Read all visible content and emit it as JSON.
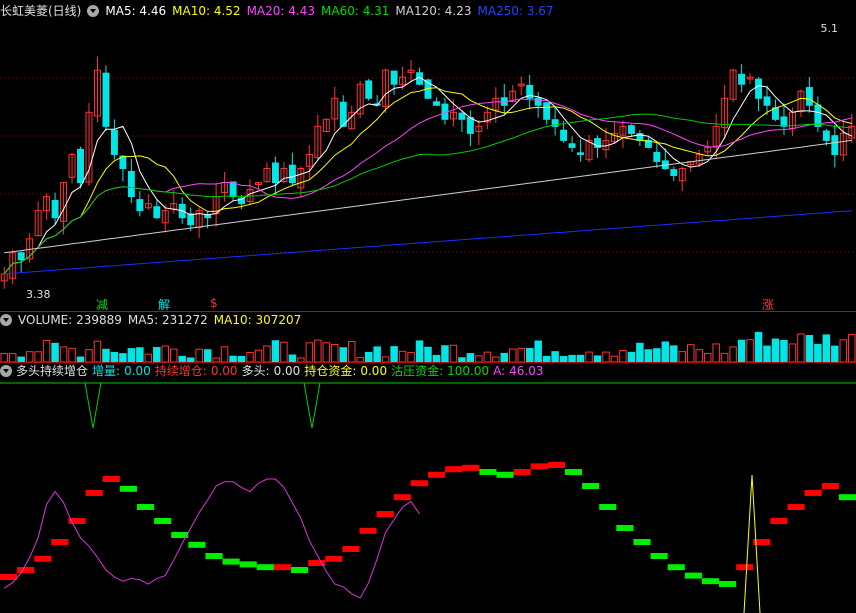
{
  "main_header": {
    "title": "长虹美菱(日线)",
    "ma5": "MA5: 4.46",
    "ma10": "MA10: 4.52",
    "ma20": "MA20: 4.43",
    "ma60": "MA60: 4.31",
    "ma120": "MA120: 4.23",
    "ma250": "MA250: 3.67"
  },
  "price_marks": {
    "high": "5.1",
    "low": "3.38"
  },
  "signals": {
    "s1": "减",
    "s2": "解",
    "s3": "$",
    "s4": "涨"
  },
  "volume_header": {
    "volume": "VOLUME: 239889",
    "ma5": "MA5: 231272",
    "ma10": "MA10: 307207"
  },
  "indicator_header": {
    "name": "多头持续增仓",
    "zl_label": "增量:",
    "zl_value": "0.00",
    "cx_label": "持续增仓:",
    "cx_value": "0.00",
    "dt_label": "多头:",
    "dt_value": "0.00",
    "cc_label": "持仓资金:",
    "cc_value": "0.00",
    "gy_label": "沽压资金:",
    "gy_value": "100.00",
    "a_label": "A:",
    "a_value": "46.03"
  },
  "colors": {
    "up": "#ff3232",
    "down": "#00e5e5",
    "ma5": "#ffffff",
    "ma10": "#ffff00",
    "ma20": "#ff44ff",
    "ma60": "#00cc00",
    "ma120": "#d0d0d0",
    "ma250": "#1a2fff",
    "grid": "#8b0000",
    "rise": "#ff0000",
    "fall": "#00ee00"
  },
  "chart_data": {
    "type": "line",
    "close": [
      3.45,
      3.6,
      3.55,
      3.7,
      3.9,
      4.0,
      3.85,
      4.1,
      4.3,
      4.1,
      4.6,
      4.9,
      4.5,
      4.3,
      4.2,
      4.0,
      3.9,
      3.95,
      3.85,
      3.9,
      3.95,
      3.85,
      3.8,
      3.9,
      3.85,
      4.0,
      4.1,
      4.0,
      3.95,
      4.05,
      4.1,
      4.2,
      4.1,
      4.2,
      4.1,
      4.2,
      4.3,
      4.5,
      4.55,
      4.7,
      4.5,
      4.6,
      4.8,
      4.7,
      4.65,
      4.9,
      4.8,
      4.85,
      4.9,
      4.8,
      4.7,
      4.65,
      4.55,
      4.6,
      4.55,
      4.45,
      4.5,
      4.6,
      4.7,
      4.65,
      4.75,
      4.8,
      4.7,
      4.65,
      4.55,
      4.5,
      4.4,
      4.35,
      4.3,
      4.4,
      4.35,
      4.4,
      4.45,
      4.5,
      4.45,
      4.4,
      4.35,
      4.25,
      4.2,
      4.15,
      4.2,
      4.25,
      4.3,
      4.35,
      4.5,
      4.7,
      4.9,
      4.8,
      4.85,
      4.7,
      4.65,
      4.55,
      4.5,
      4.6,
      4.75,
      4.65,
      4.5,
      4.4,
      4.3,
      4.45,
      4.5
    ]
  }
}
